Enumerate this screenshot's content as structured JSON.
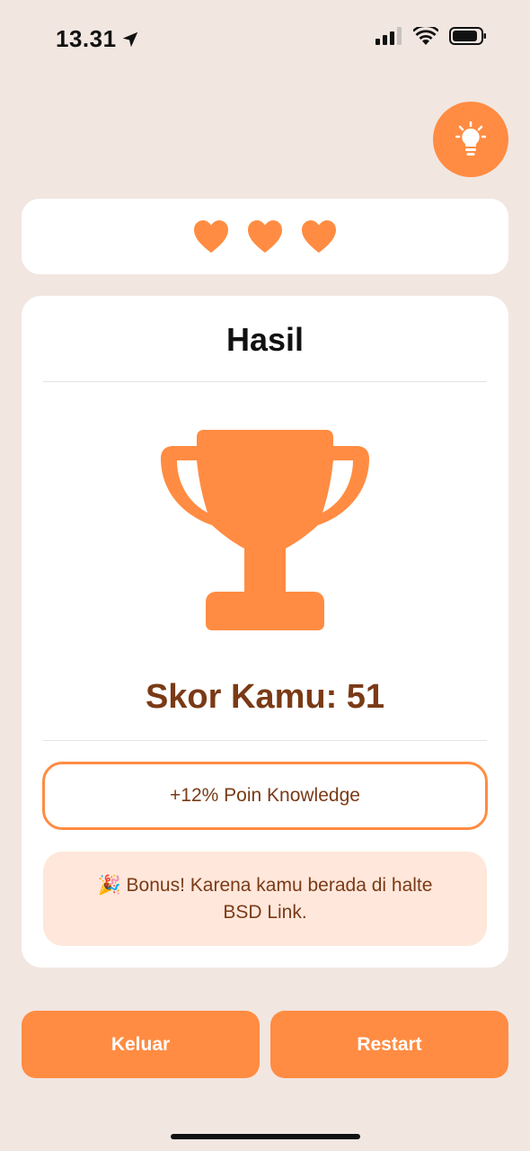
{
  "status_bar": {
    "time": "13.31",
    "icons": [
      "location-arrow-icon",
      "cellular-signal-icon",
      "wifi-icon",
      "battery-icon"
    ]
  },
  "hint_button": {
    "icon": "lightbulb-icon"
  },
  "lives": {
    "count": 3,
    "icon": "heart-icon",
    "color": "#ff8c42"
  },
  "result": {
    "title": "Hasil",
    "trophy_icon": "trophy-icon",
    "score_text": "Skor Kamu: 51",
    "poin_text": "+12% Poin Knowledge",
    "bonus_emoji": "🎉",
    "bonus_text": "Bonus! Karena kamu berada di halte BSD Link."
  },
  "actions": {
    "keluar_label": "Keluar",
    "restart_label": "Restart"
  },
  "colors": {
    "background": "#f2e6e1",
    "accent": "#ff8c42",
    "score_text": "#7a3a16",
    "bonus_bg": "#ffe7db",
    "card": "#ffffff"
  }
}
